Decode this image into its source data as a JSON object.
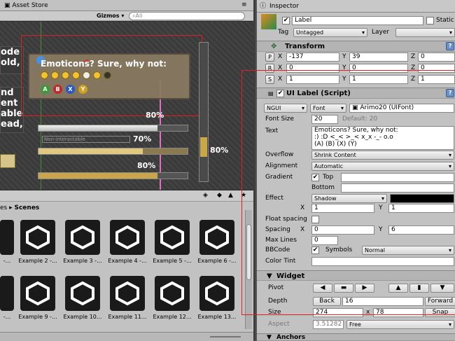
{
  "scene": {
    "tab_label": "Asset Store",
    "gizmos_label": "Gizmos ▾",
    "search_placeholder": "All",
    "left_text": [
      "ode",
      "old,",
      "nd",
      "ent",
      "able",
      "ead,"
    ],
    "widget_text": "Emoticons? Sure, why not:",
    "buttons": [
      "A",
      "B",
      "X",
      "Y"
    ],
    "bar_pcts": [
      "80%",
      "70%",
      "80%",
      "80%"
    ],
    "non_interactable": "Non-interactable"
  },
  "project": {
    "breadcrumb_prefix": "es ▸",
    "breadcrumb_current": "Scenes",
    "row1": [
      "-...",
      "Example 2 -...",
      "Example 3 -...",
      "Example 4 -...",
      "Example 5 -...",
      "Example 6 -..."
    ],
    "row2": [
      "-...",
      "Example 9 -...",
      "Example 10...",
      "Example 11...",
      "Example 12...",
      "Example 13..."
    ]
  },
  "inspector": {
    "tab_label": "Inspector",
    "object_name": "Label",
    "static_label": "Static",
    "tag_label": "Tag",
    "tag_value": "Untagged",
    "layer_label": "Layer",
    "transform_title": "Transform",
    "position": {
      "x": "-137",
      "y": "39",
      "z": "0"
    },
    "rotation": {
      "x": "0",
      "y": "0",
      "z": "0"
    },
    "scale": {
      "x": "1",
      "y": "1",
      "z": "1"
    },
    "script_title": "UI Label (Script)",
    "font_type": "NGUI",
    "font_kind": "Font",
    "font_value": "Arimo20 (UIFont)",
    "font_size_label": "Font Size",
    "font_size": "20",
    "font_size_default": "Default: 20",
    "text_label": "Text",
    "text_lines": [
      "Emoticons? Sure, why not:",
      ":) :D <_< >_< x_x -_- o.o",
      "(A) (B) (X) (Y)"
    ],
    "overflow_label": "Overflow",
    "overflow_value": "Shrink Content",
    "alignment_label": "Alignment",
    "alignment_value": "Automatic",
    "gradient_label": "Gradient",
    "top_label": "Top",
    "bottom_label": "Bottom",
    "effect_label": "Effect",
    "effect_value": "Shadow",
    "effect_x": "1",
    "effect_y": "1",
    "float_spacing_label": "Float spacing",
    "spacing_label": "Spacing",
    "spacing_x": "0",
    "spacing_y": "6",
    "max_lines_label": "Max Lines",
    "max_lines": "0",
    "bbcode_label": "BBCode",
    "symbols_label": "Symbols",
    "symbols_value": "Normal",
    "color_tint_label": "Color Tint",
    "widget_title": "Widget",
    "pivot_label": "Pivot",
    "depth_label": "Depth",
    "back_label": "Back",
    "depth_value": "16",
    "forward_label": "Forward",
    "size_label": "Size",
    "size_w": "274",
    "size_x": "x",
    "size_h": "78",
    "snap_label": "Snap",
    "aspect_label": "Aspect",
    "aspect_value": "3.51282",
    "aspect_mode": "Free",
    "anchors_title": "Anchors",
    "x_label": "X",
    "y_label": "Y",
    "z_label": "Z",
    "p_label": "P",
    "r_label": "R",
    "s_label": "S"
  },
  "colors": {
    "accent_red": "#e02020",
    "gradient_bottom": "#ffffff",
    "shadow": "#000000"
  }
}
